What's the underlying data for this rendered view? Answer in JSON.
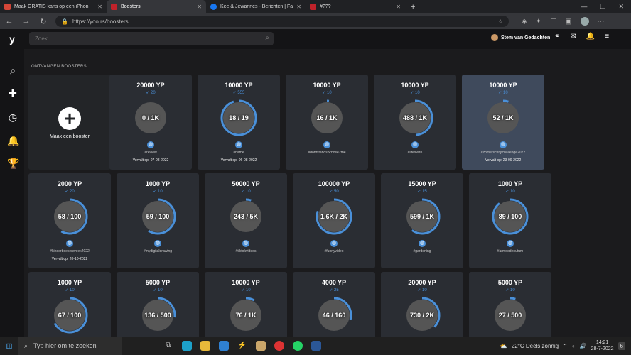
{
  "browser": {
    "tabs": [
      {
        "title": "Maak GRATIS kans op een iPhon",
        "color": "#d44638",
        "active": false
      },
      {
        "title": "Boosters",
        "color": "#c0222a",
        "active": true
      },
      {
        "title": "Kee & Jewannes - Berichten | Fac",
        "color": "#1877f2",
        "active": false
      },
      {
        "title": "#???",
        "color": "#c0222a",
        "active": false
      }
    ],
    "new_tab": "+",
    "url": "https://yoo.rs/boosters"
  },
  "app": {
    "logo": "y",
    "search_placeholder": "Zoek",
    "user_name": "Stem van Gedachten",
    "section_title": "ONTVANGEN BOOSTERS",
    "create_label": "Maak een booster"
  },
  "boosters": [
    {
      "yp": "20000 YP",
      "count": "20",
      "progress": "0 / 1K",
      "ratio": 0.0,
      "tag": "#review",
      "expiry": "Vervalt op: 07-08-2022",
      "highlight": false
    },
    {
      "yp": "10000 YP",
      "count": "555",
      "progress": "18 / 19",
      "ratio": 0.95,
      "tag": "#name",
      "expiry": "Vervalt op: 06-08-2022",
      "highlight": false
    },
    {
      "yp": "10000 YP",
      "count": "10",
      "progress": "16 / 1K",
      "ratio": 0.02,
      "tag": "#dontstandsochose2me",
      "expiry": "",
      "highlight": false
    },
    {
      "yp": "10000 YP",
      "count": "10",
      "progress": "488 / 1K",
      "ratio": 0.49,
      "tag": "#lifeswife",
      "expiry": "",
      "highlight": false
    },
    {
      "yp": "10000 YP",
      "count": "10",
      "progress": "52 / 1K",
      "ratio": 0.05,
      "tag": "#zomerschrijfchallenge2022",
      "expiry": "Vervalt op: 23-09-2022",
      "highlight": true
    },
    {
      "yp": "2000 YP",
      "count": "20",
      "progress": "58 / 100",
      "ratio": 0.58,
      "tag": "#kinderboekenweek2022",
      "expiry": "Vervalt op: 20-10-2022",
      "highlight": false
    },
    {
      "yp": "1000 YP",
      "count": "10",
      "progress": "59 / 100",
      "ratio": 0.59,
      "tag": "#mydigitaldrawing",
      "expiry": "",
      "highlight": false
    },
    {
      "yp": "50000 YP",
      "count": "10",
      "progress": "243 / 5K",
      "ratio": 0.05,
      "tag": "#tiktokvideos",
      "expiry": "",
      "highlight": false
    },
    {
      "yp": "100000 YP",
      "count": "50",
      "progress": "1.6K / 2K",
      "ratio": 0.8,
      "tag": "#funnyvideo",
      "expiry": "",
      "highlight": false
    },
    {
      "yp": "15000 YP",
      "count": "15",
      "progress": "599 / 1K",
      "ratio": 0.6,
      "tag": "#gardening",
      "expiry": "",
      "highlight": false
    },
    {
      "yp": "1000 YP",
      "count": "10",
      "progress": "89 / 100",
      "ratio": 0.89,
      "tag": "#armoedeoutum",
      "expiry": "",
      "highlight": false
    },
    {
      "yp": "1000 YP",
      "count": "10",
      "progress": "67 / 100",
      "ratio": 0.67,
      "tag": "",
      "expiry": "",
      "highlight": false
    },
    {
      "yp": "5000 YP",
      "count": "10",
      "progress": "136 / 500",
      "ratio": 0.27,
      "tag": "",
      "expiry": "",
      "highlight": false
    },
    {
      "yp": "10000 YP",
      "count": "10",
      "progress": "76 / 1K",
      "ratio": 0.08,
      "tag": "",
      "expiry": "",
      "highlight": false
    },
    {
      "yp": "4000 YP",
      "count": "25",
      "progress": "46 / 160",
      "ratio": 0.29,
      "tag": "",
      "expiry": "",
      "highlight": false
    },
    {
      "yp": "20000 YP",
      "count": "10",
      "progress": "730 / 2K",
      "ratio": 0.37,
      "tag": "",
      "expiry": "",
      "highlight": false
    },
    {
      "yp": "5000 YP",
      "count": "10",
      "progress": "27 / 500",
      "ratio": 0.05,
      "tag": "",
      "expiry": "",
      "highlight": false
    }
  ],
  "taskbar": {
    "search_placeholder": "Typ hier om te zoeken",
    "weather": "22°C  Deels zonnig",
    "time": "14:21",
    "date": "28-7-2022",
    "notifications": "6"
  },
  "colors": {
    "accent": "#4a90d9",
    "card": "#2a2d33",
    "card_highlight": "#3f4a5c"
  }
}
